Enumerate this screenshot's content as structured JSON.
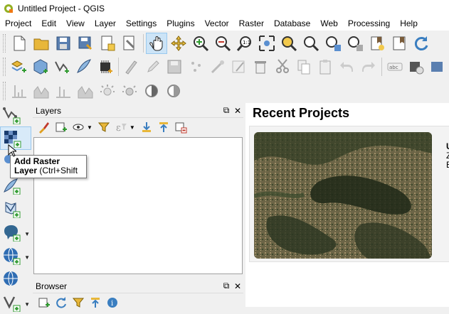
{
  "window": {
    "title": "Untitled Project - QGIS"
  },
  "menu": [
    "Project",
    "Edit",
    "View",
    "Layer",
    "Settings",
    "Plugins",
    "Vector",
    "Raster",
    "Database",
    "Web",
    "Processing",
    "Help"
  ],
  "layers_panel": {
    "title": "Layers",
    "float_icon": "⧉",
    "close_icon": "✕"
  },
  "browser_panel": {
    "title": "Browser",
    "float_icon": "⧉",
    "close_icon": "✕"
  },
  "tooltip": {
    "title": "Add Raster",
    "line2_bold": "Layer",
    "line2_rest": " (Ctrl+Shift"
  },
  "recent_projects": {
    "heading": "Recent Projects",
    "card": {
      "title": "U",
      "line1": "Z",
      "line2": "E"
    }
  },
  "colors": {
    "accent": "#3a7ec0",
    "active_button": "#cce4f7",
    "green_plus": "#2e9a2e"
  }
}
